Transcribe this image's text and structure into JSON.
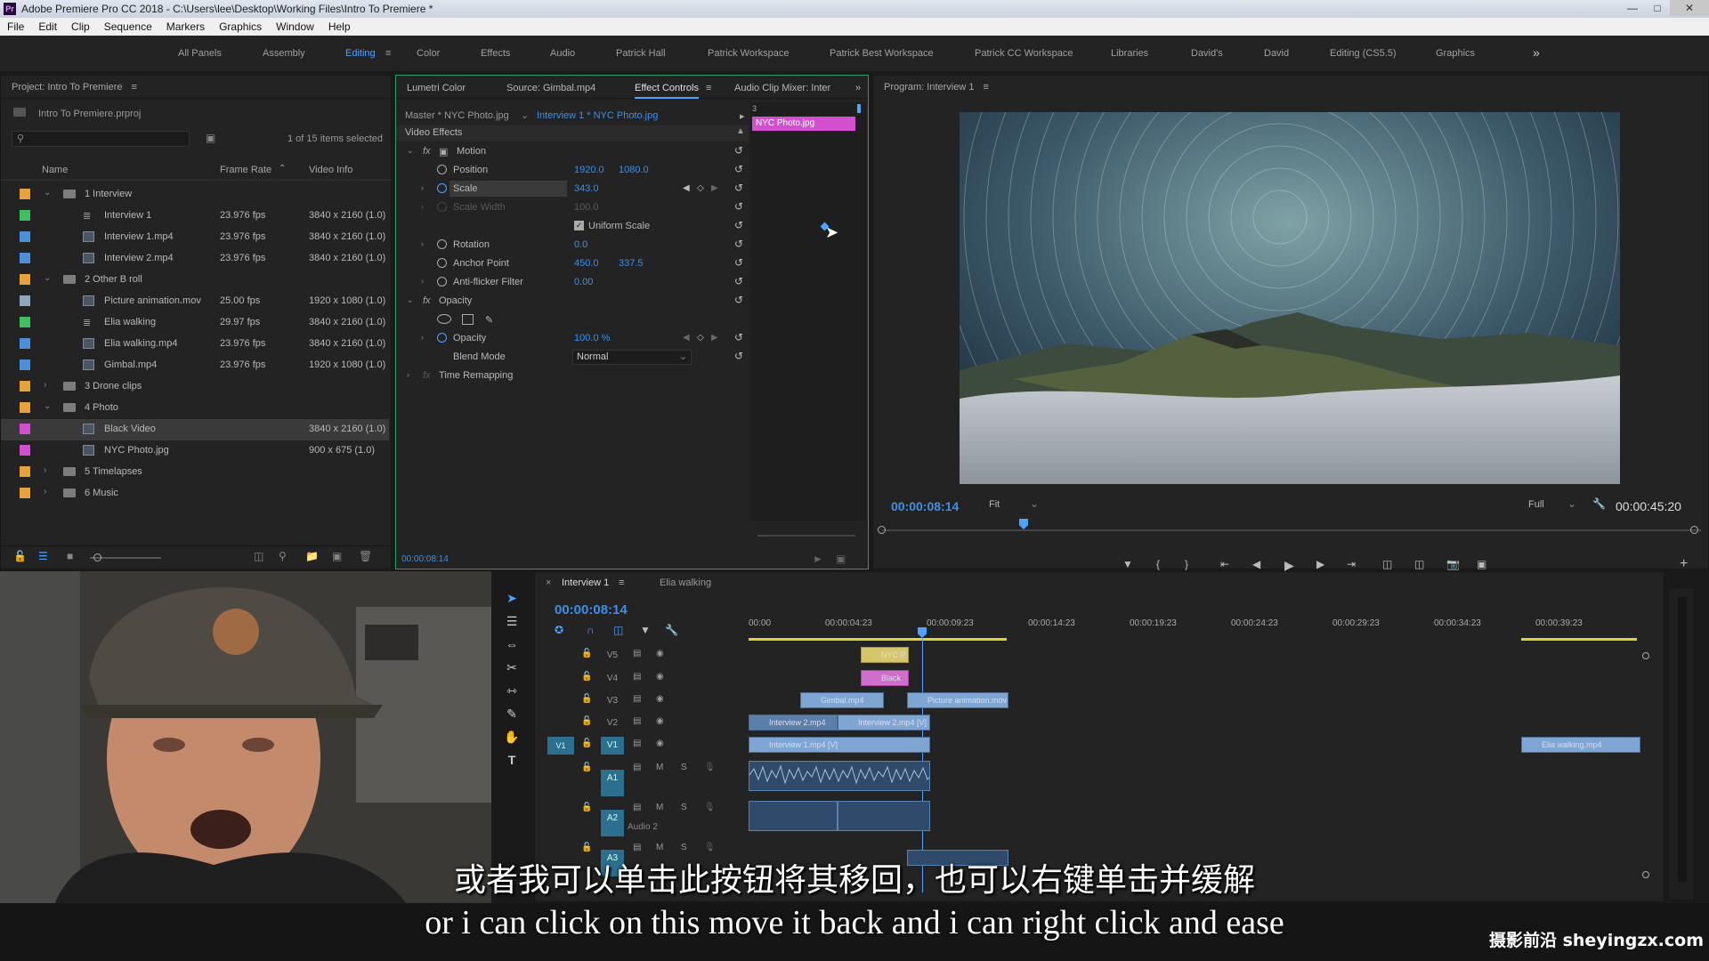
{
  "window": {
    "app_icon": "Pr",
    "title": "Adobe Premiere Pro CC 2018 - C:\\Users\\lee\\Desktop\\Working Files\\Intro To Premiere *"
  },
  "menu": [
    "File",
    "Edit",
    "Clip",
    "Sequence",
    "Markers",
    "Graphics",
    "Window",
    "Help"
  ],
  "workspaces": [
    "All Panels",
    "Assembly",
    "Editing",
    "Color",
    "Effects",
    "Audio",
    "Patrick Hall",
    "Patrick Workspace",
    "Patrick Best Workspace",
    "Patrick CC Workspace",
    "Libraries",
    "David's",
    "David",
    "Editing (CS5.5)",
    "Graphics"
  ],
  "workspace_overflow": "»",
  "project": {
    "title": "Project: Intro To Premiere",
    "file": "Intro To Premiere.prproj",
    "selection": "1 of 15 items selected",
    "columns": {
      "name": "Name",
      "frame_rate": "Frame Rate",
      "video_info": "Video Info"
    },
    "rows": [
      {
        "label_color": "#e8a23c",
        "type": "folder",
        "indent": 0,
        "name": "1 Interview",
        "fps": "",
        "info": "",
        "open": true
      },
      {
        "label_color": "#3fbf5f",
        "type": "seq",
        "indent": 1,
        "name": "Interview 1",
        "fps": "23.976 fps",
        "info": "3840 x 2160 (1.0)"
      },
      {
        "label_color": "#4a8fd8",
        "type": "clip",
        "indent": 1,
        "name": "Interview 1.mp4",
        "fps": "23.976 fps",
        "info": "3840 x 2160 (1.0)"
      },
      {
        "label_color": "#4a8fd8",
        "type": "clip",
        "indent": 1,
        "name": "Interview 2.mp4",
        "fps": "23.976 fps",
        "info": "3840 x 2160 (1.0)"
      },
      {
        "label_color": "#e8a23c",
        "type": "folder",
        "indent": 0,
        "name": "2 Other B roll",
        "fps": "",
        "info": "",
        "open": true
      },
      {
        "label_color": "#8fa8c0",
        "type": "clip",
        "indent": 1,
        "name": "Picture animation.mov",
        "fps": "25.00 fps",
        "info": "1920 x 1080 (1.0)"
      },
      {
        "label_color": "#3fbf5f",
        "type": "seq",
        "indent": 1,
        "name": "Elia walking",
        "fps": "29.97 fps",
        "info": "3840 x 2160 (1.0)"
      },
      {
        "label_color": "#4a8fd8",
        "type": "clip",
        "indent": 1,
        "name": "Elia walking.mp4",
        "fps": "23.976 fps",
        "info": "3840 x 2160 (1.0)"
      },
      {
        "label_color": "#4a8fd8",
        "type": "clip",
        "indent": 1,
        "name": "Gimbal.mp4",
        "fps": "23.976 fps",
        "info": "1920 x 1080 (1.0)"
      },
      {
        "label_color": "#e8a23c",
        "type": "folder",
        "indent": 0,
        "name": "3 Drone clips",
        "fps": "",
        "info": "",
        "open": false
      },
      {
        "label_color": "#e8a23c",
        "type": "folder",
        "indent": 0,
        "name": "4 Photo",
        "fps": "",
        "info": "",
        "open": true
      },
      {
        "label_color": "#d24fd0",
        "type": "clip",
        "indent": 1,
        "name": "Black Video",
        "fps": "",
        "info": "3840 x 2160 (1.0)",
        "selected": true
      },
      {
        "label_color": "#d24fd0",
        "type": "clip",
        "indent": 1,
        "name": "NYC Photo.jpg",
        "fps": "",
        "info": "900 x 675 (1.0)"
      },
      {
        "label_color": "#e8a23c",
        "type": "folder",
        "indent": 0,
        "name": "5 Timelapses",
        "fps": "",
        "info": "",
        "open": false
      },
      {
        "label_color": "#e8a23c",
        "type": "folder",
        "indent": 0,
        "name": "6 Music",
        "fps": "",
        "info": "",
        "open": false
      }
    ]
  },
  "effect_controls": {
    "tabs": [
      "Lumetri Color",
      "Source: Gimbal.mp4",
      "Effect Controls",
      "Audio Clip Mixer: Inter"
    ],
    "master": "Master * NYC Photo.jpg",
    "clip": "Interview 1 * NYC Photo.jpg",
    "track_clip": "NYC Photo.jpg",
    "mini_marker": "3",
    "section": "Video Effects",
    "motion": "Motion",
    "position_label": "Position",
    "position_x": "1920.0",
    "position_y": "1080.0",
    "scale_label": "Scale",
    "scale_value": "343.0",
    "scale_width_label": "Scale Width",
    "scale_width_value": "100.0",
    "uniform_scale": "Uniform Scale",
    "rotation_label": "Rotation",
    "rotation_value": "0.0",
    "anchor_label": "Anchor Point",
    "anchor_x": "450.0",
    "anchor_y": "337.5",
    "antiflicker_label": "Anti-flicker Filter",
    "antiflicker_value": "0.00",
    "opacity_section": "Opacity",
    "opacity_label": "Opacity",
    "opacity_value": "100.0 %",
    "blend_label": "Blend Mode",
    "blend_value": "Normal",
    "time_remap": "Time Remapping",
    "timecode": "00:00:08:14"
  },
  "program": {
    "title": "Program: Interview 1",
    "timecode": "00:00:08:14",
    "fit": "Fit",
    "resolution": "Full",
    "duration": "00:00:45:20"
  },
  "timeline": {
    "tabs": [
      "Interview 1",
      "Elia walking"
    ],
    "timecode": "00:00:08:14",
    "ruler": [
      "00:00",
      "00:00:04:23",
      "00:00:09:23",
      "00:00:14:23",
      "00:00:19:23",
      "00:00:24:23",
      "00:00:29:23",
      "00:00:34:23",
      "00:00:39:23"
    ],
    "tracks": [
      "V5",
      "V4",
      "V3",
      "V2",
      "V1",
      "A1",
      "A2",
      "A3"
    ],
    "source_patch": "V1",
    "track_toggles": {
      "mute": "M",
      "solo": "S"
    },
    "audio2_name": "Audio 2",
    "clips": {
      "v5": "NYC P",
      "v4": "Black",
      "v3a": "Gimbal.mp4",
      "v3b": "Picture animation.mov",
      "v2a": "Interview 2.mp4",
      "v2b": "Interview 2.mp4 [V]",
      "v1a": "Interview 1.mp4 [V]",
      "v1b": "Elia walking.mp4"
    }
  },
  "subtitles": {
    "cn": "或者我可以单击此按钮将其移回，也可以右键单击并缓解",
    "en": "or i can click on this move it back and i can right click and ease"
  },
  "watermark": "摄影前沿 sheyingzx.com"
}
